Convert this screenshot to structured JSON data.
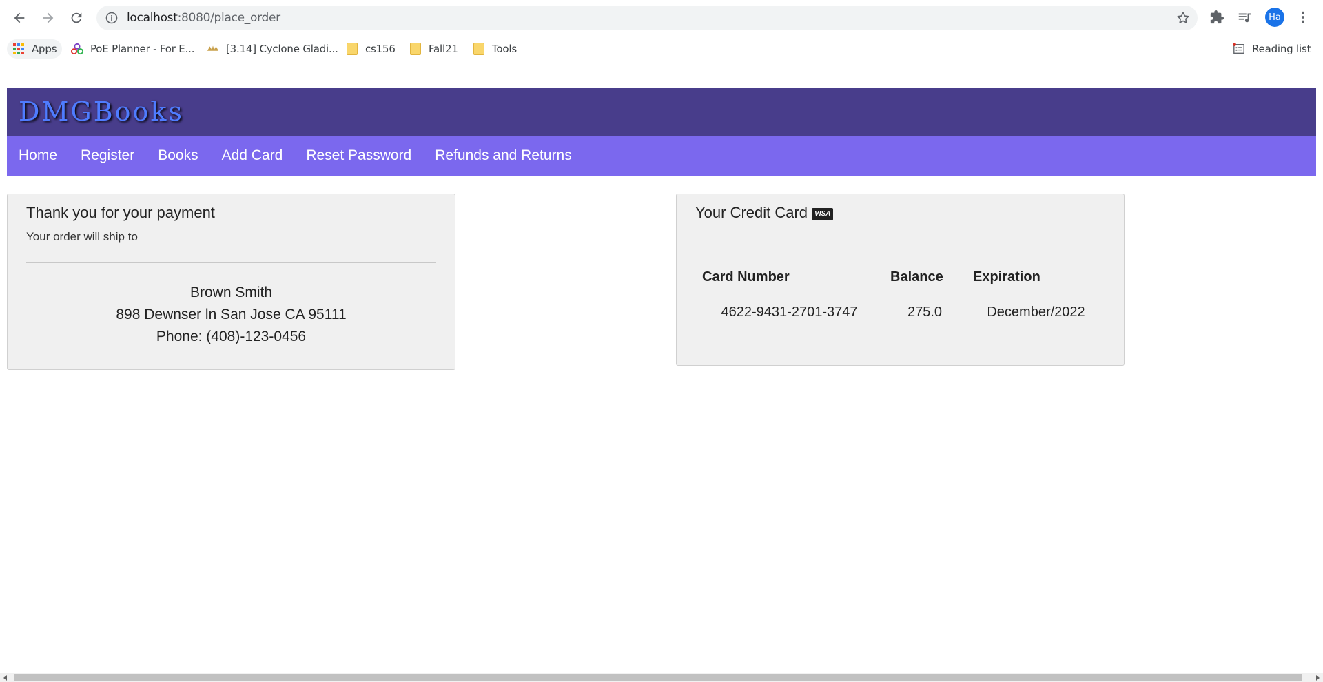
{
  "browser": {
    "url_host": "localhost",
    "url_rest": ":8080/place_order",
    "avatar_initials": "Ha",
    "bookmarks": [
      {
        "label": "Apps",
        "icon": "apps-grid-icon"
      },
      {
        "label": "PoE Planner - For E...",
        "icon": "poe-planner-icon"
      },
      {
        "label": "[3.14] Cyclone Gladi...",
        "icon": "poe-forum-icon"
      },
      {
        "label": "cs156",
        "icon": "folder-icon"
      },
      {
        "label": "Fall21",
        "icon": "folder-icon"
      },
      {
        "label": "Tools",
        "icon": "folder-icon"
      }
    ],
    "reading_list_label": "Reading list"
  },
  "site": {
    "title": "DMGBooks",
    "nav": [
      "Home",
      "Register",
      "Books",
      "Add Card",
      "Reset Password",
      "Refunds and Returns"
    ]
  },
  "order": {
    "heading": "Thank you for your payment",
    "subheading": "Your order will ship to",
    "name": "Brown Smith",
    "address": "898 Dewnser ln San Jose CA 95111",
    "phone": "Phone: (408)-123-0456"
  },
  "card": {
    "heading": "Your Credit Card",
    "badge": "VISA",
    "columns": [
      "Card Number",
      "Balance",
      "Expiration"
    ],
    "rows": [
      [
        "4622-9431-2701-3747",
        "275.0",
        "December/2022"
      ]
    ]
  },
  "colors": {
    "header_bg": "#483d8b",
    "nav_bg": "#7b68ee",
    "title_color": "#4f7cff",
    "panel_bg": "#f0f0f0"
  }
}
